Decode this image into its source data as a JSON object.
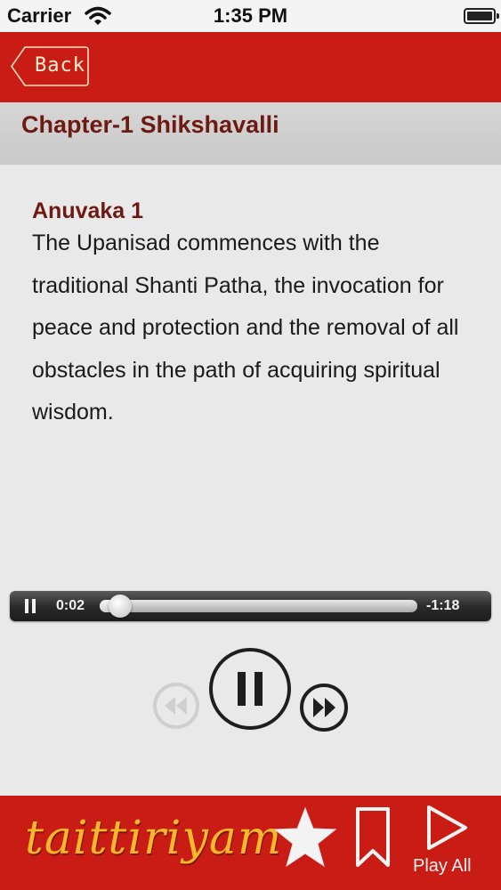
{
  "status_bar": {
    "carrier": "Carrier",
    "time": "1:35 PM"
  },
  "nav": {
    "back_label": "Back"
  },
  "chapter": {
    "title": "Chapter-1 Shikshavalli"
  },
  "section": {
    "heading": "Anuvaka 1",
    "body": "The Upanisad commences with the traditional Shanti Patha, the invocation for peace and protection and the removal of all obstacles in the path of acquiring spiritual wisdom."
  },
  "player": {
    "elapsed": "0:02",
    "remaining": "-1:18",
    "progress": 0.03
  },
  "bottom_bar": {
    "brand": "taittiriyam",
    "play_all_label": "Play All"
  },
  "icons": {
    "wifi": "wifi-icon",
    "battery": "battery-icon",
    "pause": "pause-icon",
    "rewind": "rewind-icon",
    "fast_forward": "fast-forward-icon",
    "star": "star-icon",
    "bookmark": "bookmark-icon",
    "play": "play-icon"
  },
  "colors": {
    "brand_red": "#c91c15",
    "heading_maroon": "#6d1a12",
    "logo_gold": "#f7b72a"
  }
}
